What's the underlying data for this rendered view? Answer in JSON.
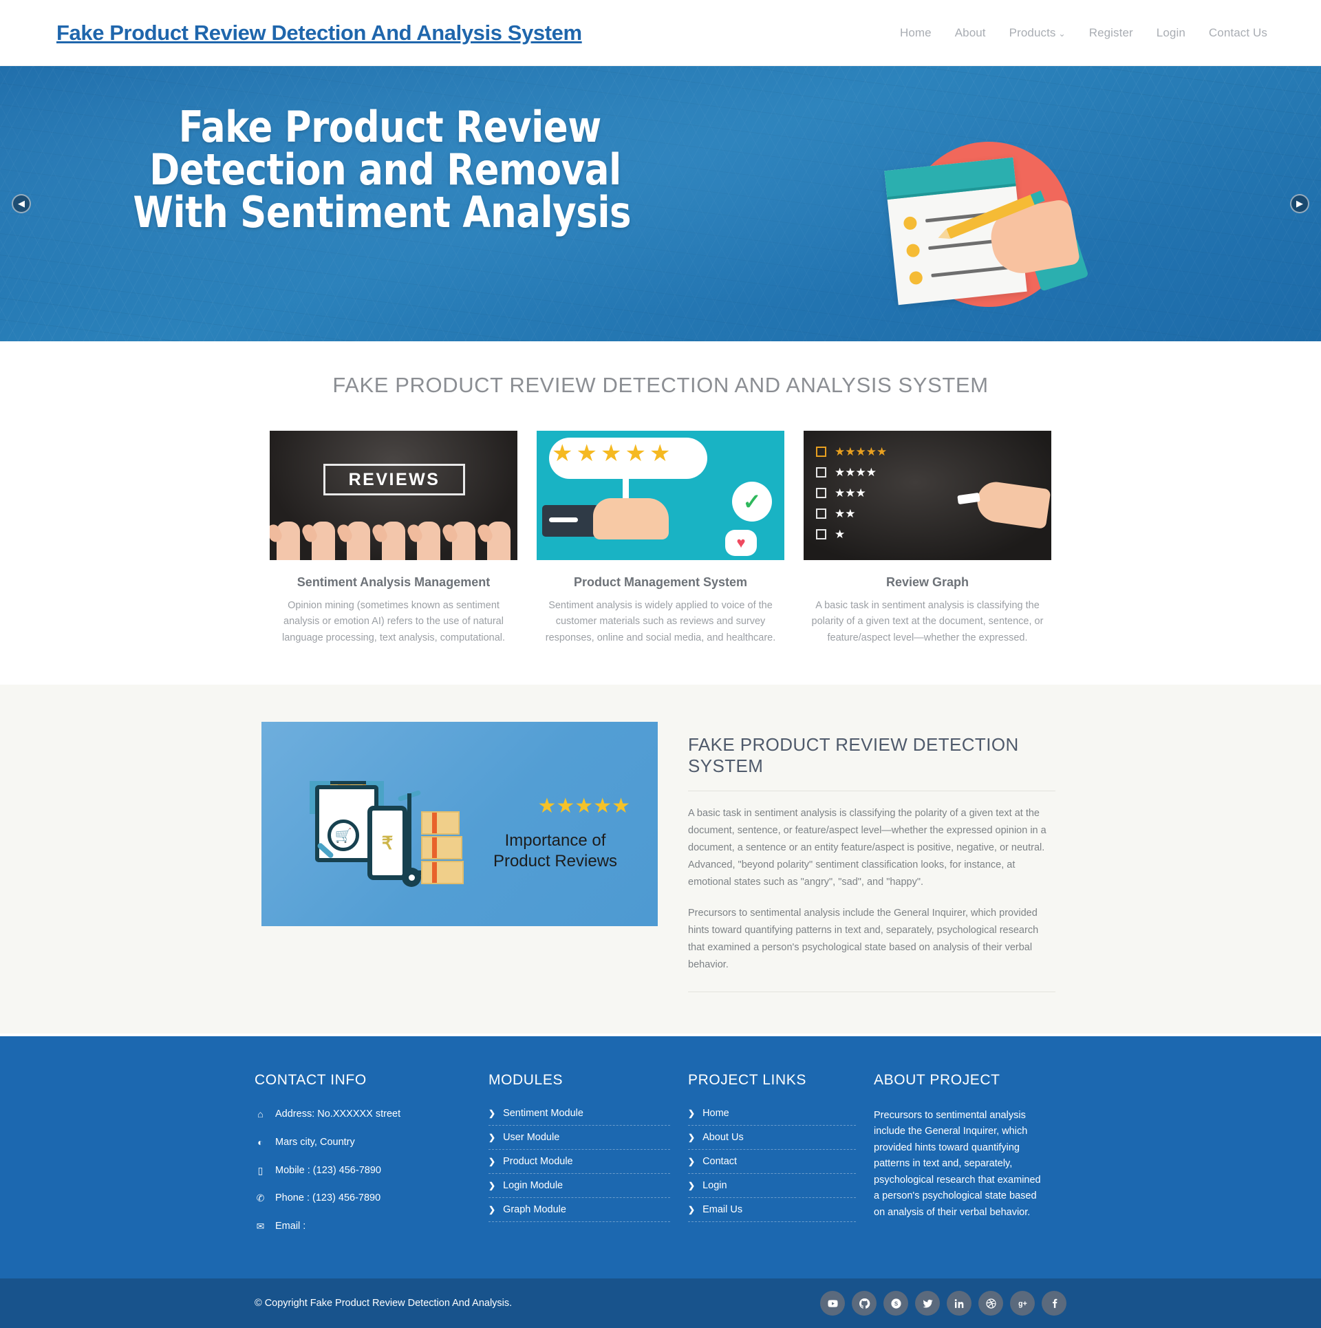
{
  "header": {
    "brand": "Fake Product Review Detection And Analysis System",
    "nav": [
      {
        "label": "Home"
      },
      {
        "label": "About"
      },
      {
        "label": "Products",
        "caret": "⌄"
      },
      {
        "label": "Register"
      },
      {
        "label": "Login"
      },
      {
        "label": "Contact Us"
      }
    ]
  },
  "hero": {
    "line1": "Fake Product Review",
    "line2": "Detection and Removal",
    "line3": "With Sentiment Analysis",
    "prev_icon": "◀",
    "next_icon": "▶",
    "art_caption": ""
  },
  "features": {
    "title": "FAKE PRODUCT REVIEW DETECTION AND ANALYSIS SYSTEM",
    "cards": [
      {
        "image_text": "REVIEWS",
        "title": "Sentiment Analysis Management",
        "text": "Opinion mining (sometimes known as sentiment analysis or emotion AI) refers to the use of natural language processing, text analysis, computational."
      },
      {
        "image_text": "",
        "title": "Product Management System",
        "text": "Sentiment analysis is widely applied to voice of the customer materials such as reviews and survey responses, online and social media, and healthcare."
      },
      {
        "image_text": "",
        "title": "Review Graph",
        "text": "A basic task in sentiment analysis is classifying the polarity of a given text at the document, sentence, or feature/aspect level—whether the expressed."
      }
    ]
  },
  "about": {
    "image": {
      "caption_line1": "Importance of",
      "caption_line2": "Product Reviews",
      "currency": "₹",
      "plus": "+",
      "stars": "★★★★★"
    },
    "title": "FAKE PRODUCT REVIEW DETECTION SYSTEM",
    "paragraph1": "A basic task in sentiment analysis is classifying the polarity of a given text at the document, sentence, or feature/aspect level—whether the expressed opinion in a document, a sentence or an entity feature/aspect is positive, negative, or neutral. Advanced, \"beyond polarity\" sentiment classification looks, for instance, at emotional states such as \"angry\", \"sad\", and \"happy\".",
    "paragraph2": "Precursors to sentimental analysis include the General Inquirer, which provided hints toward quantifying patterns in text and, separately, psychological research that examined a person's psychological state based on analysis of their verbal behavior."
  },
  "footer": {
    "contact": {
      "title": "CONTACT INFO",
      "items": [
        {
          "icon": "home-icon",
          "glyph": "⌂",
          "text": "Address: No.XXXXXX street"
        },
        {
          "icon": "globe-icon",
          "glyph": "◐",
          "text": "Mars city, Country"
        },
        {
          "icon": "mobile-icon",
          "glyph": "▯",
          "text": "Mobile : (123) 456-7890"
        },
        {
          "icon": "phone-icon",
          "glyph": "✆",
          "text": "Phone : (123) 456-7890"
        },
        {
          "icon": "envelope-icon",
          "glyph": "✉",
          "text": "Email :"
        }
      ]
    },
    "modules": {
      "title": "MODULES",
      "items": [
        {
          "label": "Sentiment Module"
        },
        {
          "label": "User Module"
        },
        {
          "label": "Product Module"
        },
        {
          "label": "Login Module"
        },
        {
          "label": "Graph Module"
        }
      ]
    },
    "links": {
      "title": "PROJECT LINKS",
      "items": [
        {
          "label": "Home"
        },
        {
          "label": "About Us"
        },
        {
          "label": "Contact"
        },
        {
          "label": "Login"
        },
        {
          "label": "Email Us"
        }
      ]
    },
    "about_project": {
      "title": "ABOUT PROJECT",
      "text": "Precursors to sentimental analysis include the General Inquirer, which provided hints toward quantifying patterns in text and, separately, psychological research that examined a person's psychological state based on analysis of their verbal behavior."
    },
    "chevron": "❯",
    "copyright": "© Copyright Fake Product Review Detection And Analysis.",
    "socials": [
      {
        "name": "youtube-icon",
        "glyph": "▶"
      },
      {
        "name": "github-icon",
        "glyph": "◍"
      },
      {
        "name": "skype-icon",
        "glyph": "S"
      },
      {
        "name": "twitter-icon",
        "glyph": "🐦"
      },
      {
        "name": "linkedin-icon",
        "glyph": "in"
      },
      {
        "name": "dribbble-icon",
        "glyph": "◉"
      },
      {
        "name": "googleplus-icon",
        "glyph": "g+"
      },
      {
        "name": "facebook-icon",
        "glyph": "f"
      }
    ]
  },
  "colors": {
    "brand_blue": "#1f66ac",
    "footer_blue": "#1c68b0",
    "copyright_blue": "#18538c",
    "hero_blue": "#2b82bb",
    "accent_orange": "#f5b921",
    "muted_text": "#9b9fa4"
  }
}
